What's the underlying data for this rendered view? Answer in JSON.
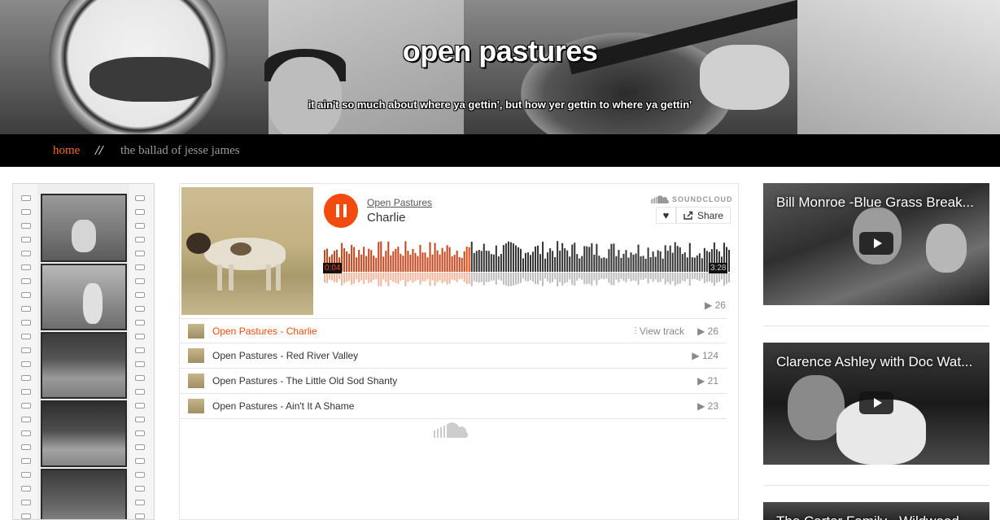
{
  "site": {
    "title": "open pastures",
    "tagline": "it ain't so much about where ya gettin', but how yer gettin to where ya gettin'"
  },
  "nav": {
    "home": "home",
    "separator": "//",
    "current": "the ballad of jesse james"
  },
  "player": {
    "artist": "Open Pastures",
    "track_title": "Charlie",
    "logo_text": "SOUNDCLOUD",
    "share_label": "Share",
    "time_elapsed": "0:04",
    "time_total": "3:28",
    "progress_fraction": 0.36,
    "plays": "26",
    "accent_color": "#f24b0d",
    "tracks": [
      {
        "name": "Open Pastures - Charlie",
        "plays": "26",
        "view_label": "View track",
        "active": true
      },
      {
        "name": "Open Pastures - Red River Valley",
        "plays": "124"
      },
      {
        "name": "Open Pastures - The Little Old Sod Shanty",
        "plays": "21"
      },
      {
        "name": "Open Pastures - Ain't It A Shame",
        "plays": "23"
      }
    ]
  },
  "videos": [
    {
      "title": "Bill Monroe -Blue Grass Break..."
    },
    {
      "title": "Clarence Ashley with Doc Wat..."
    },
    {
      "title": "The Carter Family - Wildwood..."
    }
  ]
}
